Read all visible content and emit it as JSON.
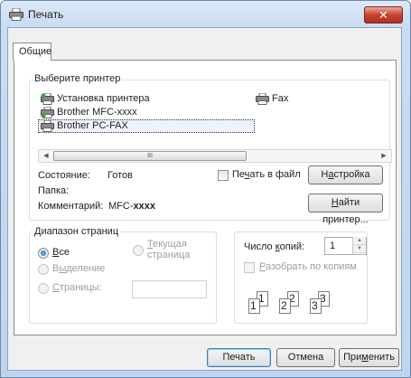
{
  "window": {
    "title": "Печать",
    "close_label": "✕"
  },
  "tabs": [
    {
      "label": "Общие"
    }
  ],
  "select_printer": {
    "group_title": "Выберите принтер",
    "printers": [
      {
        "name": "Установка принтера",
        "icon": "add-printer-icon"
      },
      {
        "name": "Fax",
        "icon": "fax-printer-icon"
      },
      {
        "name": "Brother MFC-xxxx",
        "icon": "printer-icon"
      },
      {
        "name": "Brother PC-FAX",
        "icon": "printer-icon",
        "selected": true
      }
    ],
    "scroll_thumb_glyph": "III"
  },
  "status": {
    "state_label": "Состояние:",
    "state_value": "Готов",
    "folder_label": "Папка:",
    "comment_label": "Комментарий:",
    "comment_value_prefix": "MFC-",
    "comment_value_bold": "xxxx"
  },
  "print_to_file": {
    "label_pre": "Пе",
    "label_ul": "ч",
    "label_post": "ать в файл",
    "checked": false
  },
  "buttons": {
    "setup": {
      "pre": "Н",
      "ul": "а",
      "post": "стройка"
    },
    "find_printer": {
      "pre": "",
      "ul": "Н",
      "post": "айти принтер..."
    },
    "print": "Печать",
    "cancel": "Отмена",
    "apply": {
      "pre": "При",
      "ul": "м",
      "post": "енить"
    }
  },
  "page_range": {
    "group_title": "Диапазон страниц",
    "all": {
      "pre": "",
      "ul": "В",
      "post": "се",
      "selected": true
    },
    "current_page_line1_pre": "",
    "current_page_line1_ul": "Т",
    "current_page_line1_post": "екущая",
    "current_page_line2": "страница",
    "selection": {
      "pre": "В",
      "ul": "ы",
      "post": "деление"
    },
    "pages": {
      "pre": "",
      "ul": "С",
      "post": "траницы:"
    },
    "pages_value": ""
  },
  "copies": {
    "label_pre": "Число ",
    "label_ul": "к",
    "label_post": "опий:",
    "value": "1",
    "collate": {
      "pre": "",
      "ul": "Р",
      "post": "азобрать по копиям",
      "checked": false
    },
    "collate_pages": [
      "1",
      "1",
      "2",
      "2",
      "3",
      "3"
    ]
  },
  "colors": {
    "accent": "#3c7fb1",
    "close": "#c7432d"
  }
}
